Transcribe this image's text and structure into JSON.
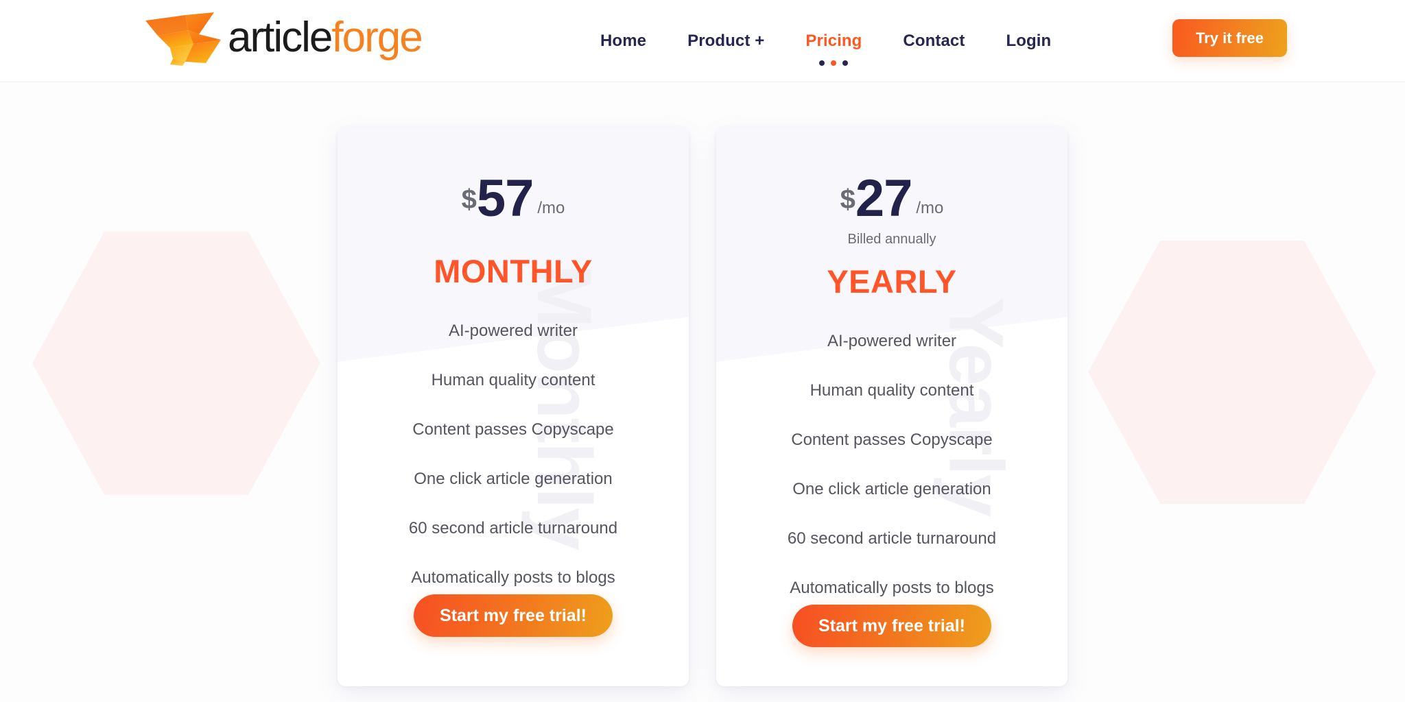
{
  "brand": {
    "name_dark": "article",
    "name_accent": "forge",
    "logo_icon": "origami-bird-logo"
  },
  "header": {
    "nav": [
      {
        "label": "Home",
        "active": false
      },
      {
        "label": "Product +",
        "active": false
      },
      {
        "label": "Pricing",
        "active": true
      },
      {
        "label": "Contact",
        "active": false
      },
      {
        "label": "Login",
        "active": false
      }
    ],
    "cta_label": "Try it free"
  },
  "colors": {
    "accent_orange": "#ff5722",
    "price_navy": "#22224a",
    "muted_gray": "#6b6b76",
    "hex_pink": "#fdf1f1",
    "card_wash": "#f7f7fc",
    "watermark": "#f1f1f5"
  },
  "plans": [
    {
      "currency": "$",
      "price": "57",
      "period": "/mo",
      "billed_note": "",
      "title": "MONTHLY",
      "watermark": "Monthly",
      "features": [
        "AI-powered writer",
        "Human quality content",
        "Content passes Copyscape",
        "One click article generation",
        "60 second article turnaround",
        "Automatically posts to blogs"
      ],
      "cta_label": "Start my free trial!"
    },
    {
      "currency": "$",
      "price": "27",
      "period": "/mo",
      "billed_note": "Billed annually",
      "title": "YEARLY",
      "watermark": "Yearly",
      "features": [
        "AI-powered writer",
        "Human quality content",
        "Content passes Copyscape",
        "One click article generation",
        "60 second article turnaround",
        "Automatically posts to blogs"
      ],
      "cta_label": "Start my free trial!"
    }
  ]
}
